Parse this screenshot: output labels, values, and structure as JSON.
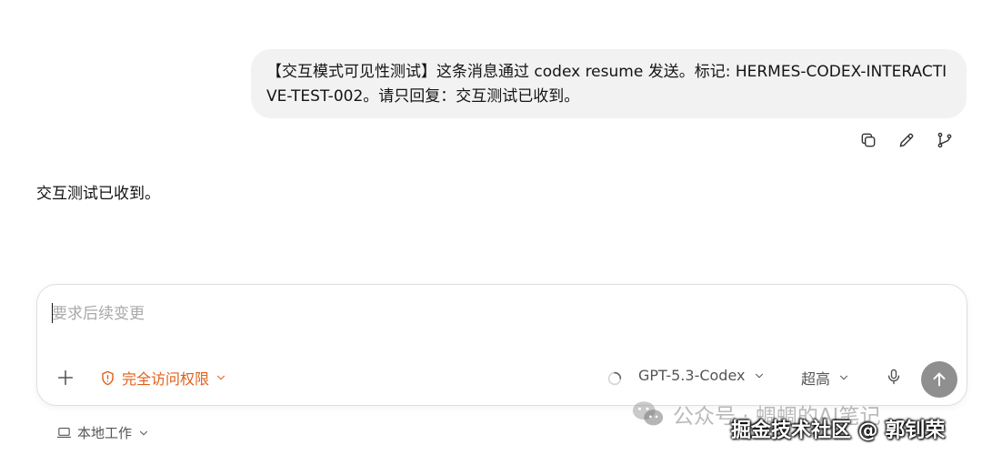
{
  "conversation": {
    "user_message": "【交互模式可见性测试】这条消息通过 codex resume 发送。标记: HERMES-CODEX-INTERACTIVE-TEST-002。请只回复：交互测试已收到。",
    "assistant_reply": "交互测试已收到。",
    "message_actions": [
      {
        "icon": "copy-icon"
      },
      {
        "icon": "edit-pencil-icon"
      },
      {
        "icon": "branch-icon"
      }
    ]
  },
  "composer": {
    "placeholder": "要求后续变更",
    "value": "",
    "access_label": "完全访问权限",
    "model_label": "GPT-5.3-Codex",
    "effort_label": "超高",
    "access_color": "#e0601a",
    "send_button_color": "#8f8f8f"
  },
  "footer": {
    "workspace_label": "本地工作"
  },
  "watermarks": {
    "wechat": "公众号 · 蜩蜩的AI笔记",
    "juejin": "掘金技术社区 @ 郭钊荣"
  }
}
